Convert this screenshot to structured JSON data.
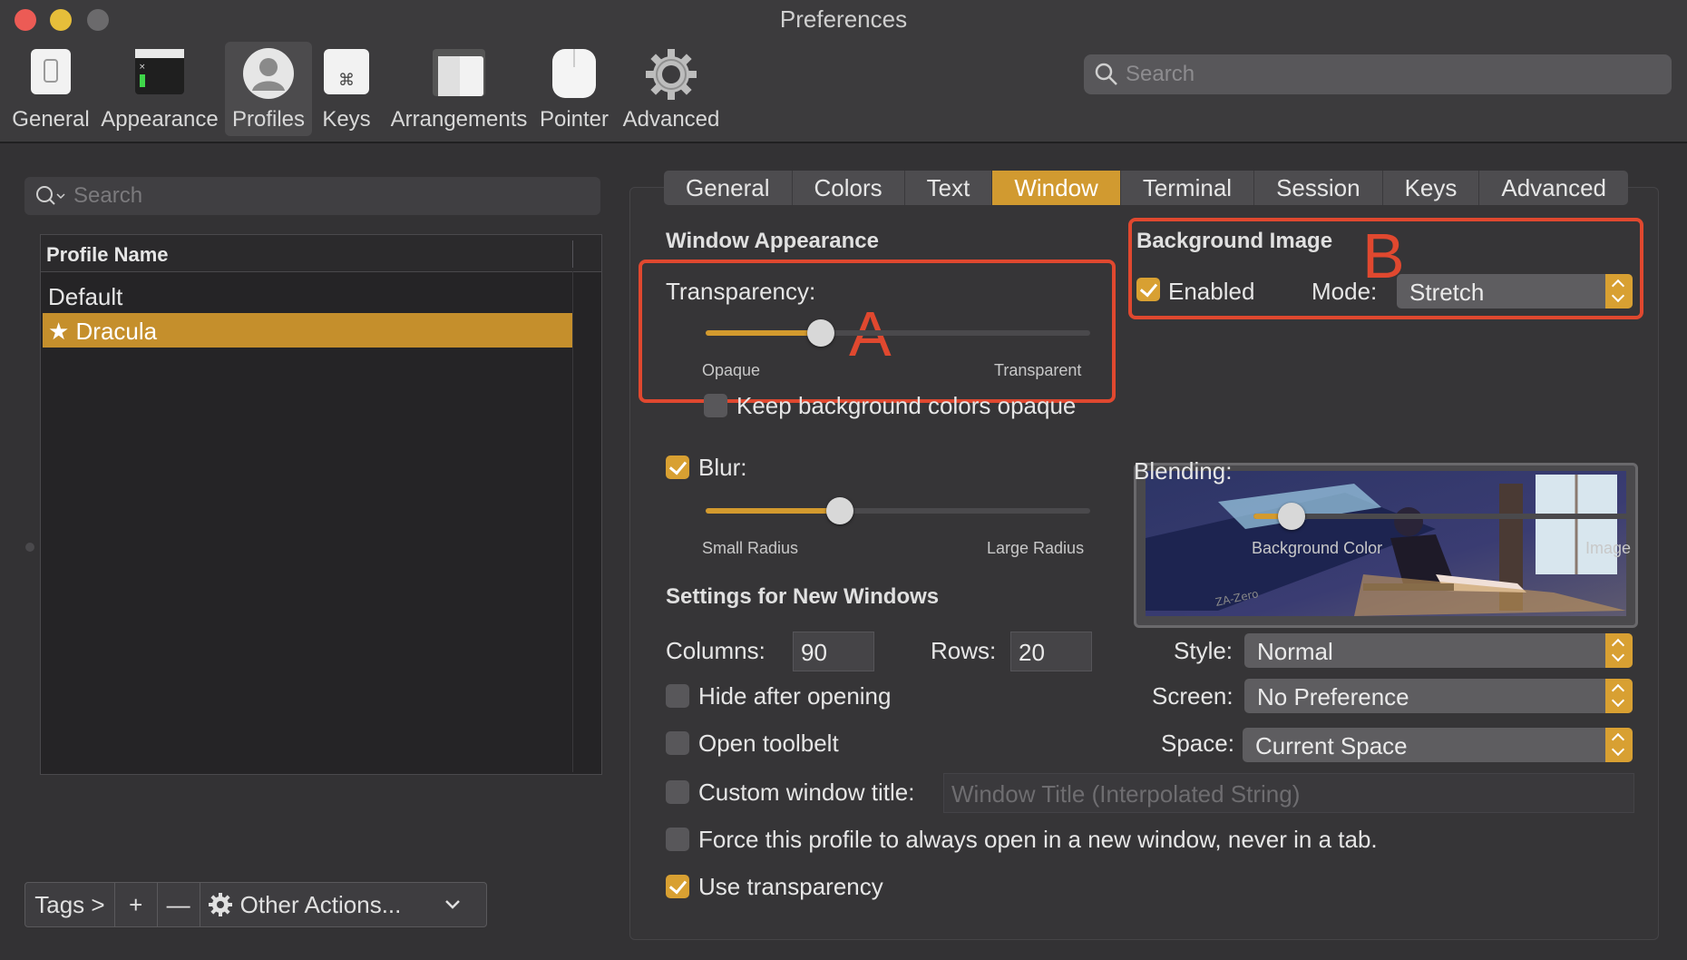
{
  "window": {
    "title": "Preferences"
  },
  "toolbar": {
    "items": [
      {
        "label": "General",
        "icon": "general-switch-icon"
      },
      {
        "label": "Appearance",
        "icon": "appearance-window-icon"
      },
      {
        "label": "Profiles",
        "icon": "profiles-person-icon",
        "selected": true
      },
      {
        "label": "Keys",
        "icon": "keys-command-icon"
      },
      {
        "label": "Arrangements",
        "icon": "arrangements-icon"
      },
      {
        "label": "Pointer",
        "icon": "pointer-mouse-icon"
      },
      {
        "label": "Advanced",
        "icon": "advanced-gear-icon"
      }
    ],
    "search_placeholder": "Search"
  },
  "sidebar": {
    "search_placeholder": "Search",
    "column_header": "Profile Name",
    "profiles": [
      {
        "name": "Default",
        "selected": false
      },
      {
        "name": "★ Dracula",
        "selected": true
      }
    ],
    "bottom": {
      "tags": "Tags >",
      "add": "+",
      "remove": "—",
      "other_actions": "Other Actions..."
    }
  },
  "tabs": [
    "General",
    "Colors",
    "Text",
    "Window",
    "Terminal",
    "Session",
    "Keys",
    "Advanced"
  ],
  "active_tab": "Window",
  "window_appearance": {
    "heading": "Window Appearance",
    "transparency_label": "Transparency:",
    "transparency_value": 0.3,
    "opaque_label": "Opaque",
    "transparent_label": "Transparent",
    "keep_bg_opaque_label": "Keep background colors opaque",
    "keep_bg_opaque_checked": false,
    "blur_label": "Blur:",
    "blur_checked": true,
    "blur_value": 0.35,
    "small_radius_label": "Small Radius",
    "large_radius_label": "Large Radius"
  },
  "background_image": {
    "heading": "Background Image",
    "enabled_label": "Enabled",
    "enabled_checked": true,
    "mode_label": "Mode:",
    "mode_value": "Stretch",
    "image_caption": "ZA-Zero",
    "blending_label": "Blending:",
    "blending_value": 0.1,
    "bg_color_label": "Background Color",
    "image_label": "Image"
  },
  "annotations": {
    "a": "A",
    "b": "B",
    "color": "#e0482f"
  },
  "new_windows": {
    "heading": "Settings for New Windows",
    "columns_label": "Columns:",
    "columns_value": "90",
    "rows_label": "Rows:",
    "rows_value": "20",
    "style_label": "Style:",
    "style_value": "Normal",
    "screen_label": "Screen:",
    "screen_value": "No Preference",
    "space_label": "Space:",
    "space_value": "Current Space",
    "hide_after_opening": {
      "label": "Hide after opening",
      "checked": false
    },
    "open_toolbelt": {
      "label": "Open toolbelt",
      "checked": false
    },
    "custom_title": {
      "label": "Custom window title:",
      "checked": false,
      "placeholder": "Window Title (Interpolated String)"
    },
    "force_new_window": {
      "label": "Force this profile to always open in a new window, never in a tab.",
      "checked": false
    },
    "use_transparency": {
      "label": "Use transparency",
      "checked": true
    }
  },
  "colors": {
    "accent": "#d39a2e",
    "selection": "#c58f2c",
    "background": "#333234"
  }
}
